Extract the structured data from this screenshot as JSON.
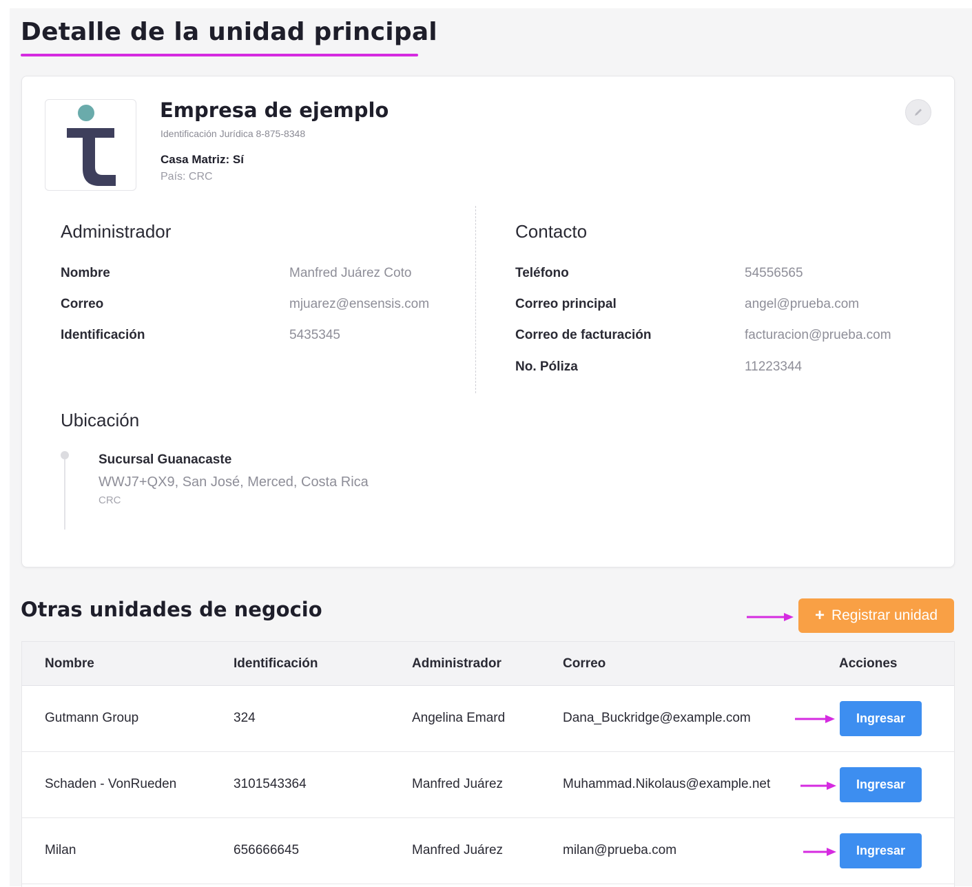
{
  "page": {
    "title": "Detalle de la unidad principal",
    "accent_color": "#d52be0"
  },
  "company": {
    "name": "Empresa de ejemplo",
    "legal_id": "Identificación Jurídica 8-875-8348",
    "headquarters": "Casa Matriz: Sí",
    "country": "País: CRC",
    "edit_icon": "pencil-icon"
  },
  "administrator": {
    "heading": "Administrador",
    "fields": [
      {
        "label": "Nombre",
        "value": "Manfred Juárez Coto"
      },
      {
        "label": "Correo",
        "value": "mjuarez@ensensis.com"
      },
      {
        "label": "Identificación",
        "value": "5435345"
      }
    ]
  },
  "contact": {
    "heading": "Contacto",
    "fields": [
      {
        "label": "Teléfono",
        "value": "54556565"
      },
      {
        "label": "Correo principal",
        "value": "angel@prueba.com"
      },
      {
        "label": "Correo de facturación",
        "value": "facturacion@prueba.com"
      },
      {
        "label": "No. Póliza",
        "value": "11223344"
      }
    ]
  },
  "location": {
    "heading": "Ubicación",
    "name": "Sucursal Guanacaste",
    "address": "WWJ7+QX9, San José, Merced, Costa Rica",
    "country": "CRC"
  },
  "other_units": {
    "heading": "Otras unidades de negocio",
    "register_label": "Registrar unidad",
    "register_icon": "plus-icon",
    "register_color": "#f9a045",
    "columns": [
      "Nombre",
      "Identificación",
      "Administrador",
      "Correo",
      "Acciones"
    ],
    "rows": [
      {
        "name": "Gutmann Group",
        "id": "324",
        "admin": "Angelina Emard",
        "email": "Dana_Buckridge@example.com",
        "action": "Ingresar"
      },
      {
        "name": "Schaden - VonRueden",
        "id": "3101543364",
        "admin": "Manfred Juárez",
        "email": "Muhammad.Nikolaus@example.net",
        "action": "Ingresar"
      },
      {
        "name": "Milan",
        "id": "656666645",
        "admin": "Manfred Juárez",
        "email": "milan@prueba.com",
        "action": "Ingresar"
      }
    ],
    "action_color": "#3d8ef0"
  }
}
